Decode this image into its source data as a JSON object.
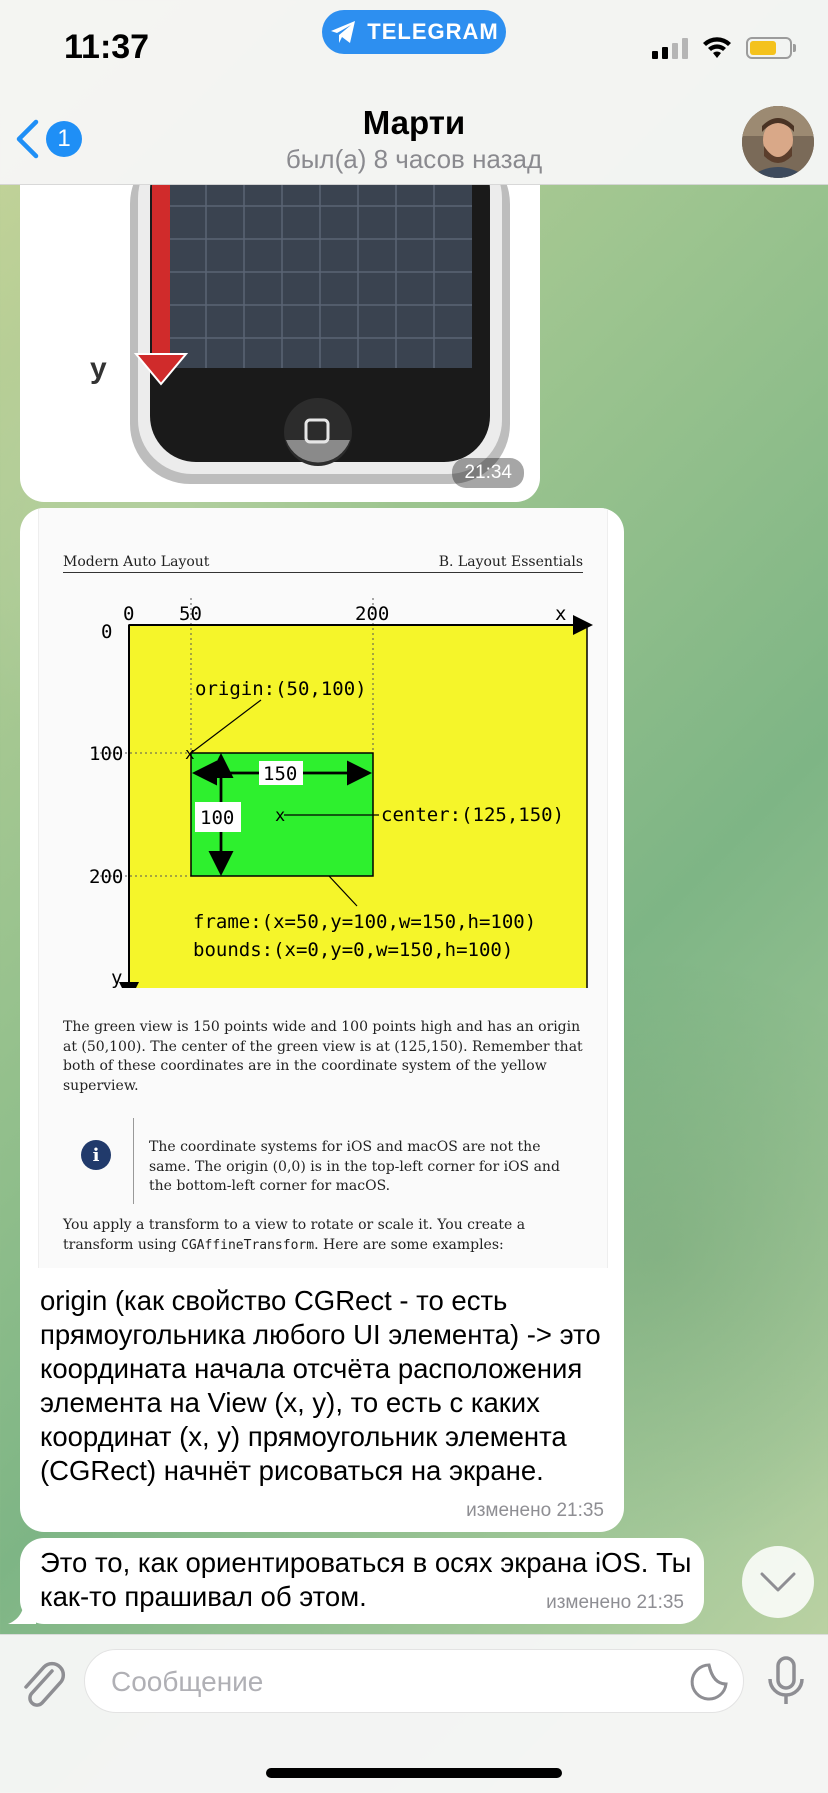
{
  "status_bar": {
    "time": "11:37",
    "app_pill": "TELEGRAM",
    "battery_color": "#f4c21d"
  },
  "header": {
    "back_badge": "1",
    "contact_name": "Марти",
    "contact_status": "был(а) 8 часов назад"
  },
  "messages": {
    "image1": {
      "axis_y_label": "y",
      "time": "21:34"
    },
    "doc": {
      "head_left": "Modern Auto Layout",
      "head_right": "B. Layout Essentials",
      "diagram": {
        "x_ticks": [
          "0",
          "50",
          "200"
        ],
        "y_ticks": [
          "0",
          "100",
          "200"
        ],
        "x_axis": "x",
        "y_axis": "y",
        "origin_label": "origin:(50,100)",
        "width_label": "150",
        "height_label": "100",
        "center_mark": "x",
        "origin_mark": "x",
        "center_label": "center:(125,150)",
        "frame_label": "frame:(x=50,y=100,w=150,h=100)",
        "bounds_label": "bounds:(x=0,y=0,w=150,h=100)"
      },
      "para1": "The green view is 150 points wide and 100 points high and has an origin at (50,100). The center of the green view is at (125,150). Remember that both of these coordinates are in the coordinate system of the yellow superview.",
      "info_icon": "i",
      "info_text": "The coordinate systems for iOS and macOS are not the same. The origin (0,0) is in the top-left corner for iOS and the bottom-left corner for macOS.",
      "para2_a": "You apply a transform to a view to rotate or scale it. You create a transform using ",
      "para2_code": "CGAffineTransform",
      "para2_b": ". Here are some examples:"
    },
    "caption": {
      "text": "origin (как свойство CGRect - то есть прямоугольника любого UI элемента) -> это координата начала отсчёта расположения элемента на View (x, y), то есть с каких координат (x, y) прямоугольник элемента (CGRect) начнёт рисоваться на экране.",
      "meta": "изменено 21:35"
    },
    "msg2": {
      "text": "Это то, как ориентироваться в осях экрана iOS. Ты как-то прашивал об этом.",
      "meta": "изменено 21:35"
    }
  },
  "input": {
    "placeholder": "Сообщение"
  },
  "colors": {
    "accent": "#1f8ff6",
    "diagram_yellow": "#f5f52a",
    "diagram_green": "#2ef02e"
  }
}
